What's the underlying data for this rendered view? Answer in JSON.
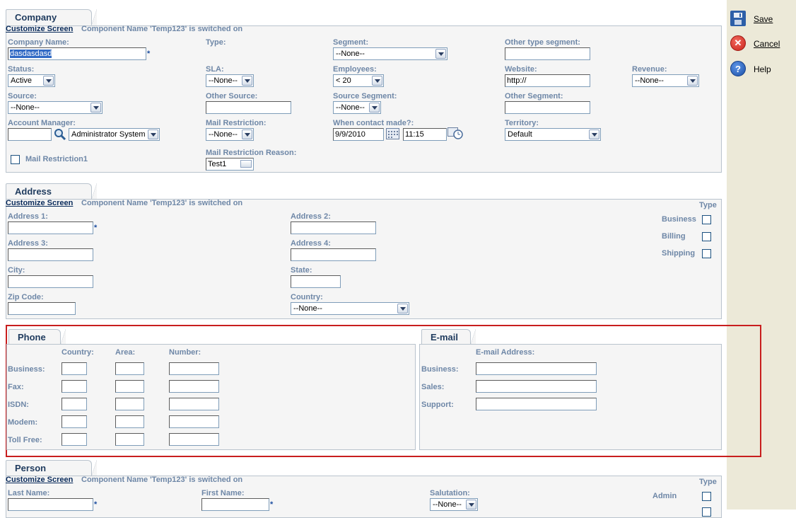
{
  "side": {
    "save_label": "Save",
    "cancel_label": "Cancel",
    "help_label": "Help"
  },
  "customize": {
    "link": "Customize Screen",
    "note": "Component Name 'Temp123' is switched on"
  },
  "company": {
    "tab": "Company",
    "company_name_label": "Company Name:",
    "company_name_value": "dasdasdasd",
    "type_label": "Type:",
    "segment_label": "Segment:",
    "segment_value": "--None--",
    "other_type_segment_label": "Other type segment:",
    "status_label": "Status:",
    "status_value": "Active",
    "sla_label": "SLA:",
    "sla_value": "--None--",
    "employees_label": "Employees:",
    "employees_value": "< 20",
    "website_label": "Website:",
    "website_value": "http://",
    "revenue_label": "Revenue:",
    "revenue_value": "--None--",
    "source_label": "Source:",
    "source_value": "--None--",
    "other_source_label": "Other Source:",
    "source_segment_label": "Source Segment:",
    "source_segment_value": "--None--",
    "other_segment_label": "Other Segment:",
    "account_manager_label": "Account Manager:",
    "account_manager_value": "Administrator System",
    "mail_restriction_label": "Mail Restriction:",
    "mail_restriction_value": "--None--",
    "contact_made_label": "When contact made?:",
    "contact_date": "9/9/2010",
    "contact_time": "11:15",
    "territory_label": "Territory:",
    "territory_value": "Default",
    "mail_restriction1_label": "Mail Restriction1",
    "mail_restriction_reason_label": "Mail Restriction Reason:",
    "mail_restriction_reason_value": "Test1"
  },
  "address": {
    "tab": "Address",
    "address1_label": "Address 1:",
    "address2_label": "Address 2:",
    "address3_label": "Address 3:",
    "address4_label": "Address 4:",
    "city_label": "City:",
    "state_label": "State:",
    "zip_label": "Zip Code:",
    "country_label": "Country:",
    "country_value": "--None--",
    "type_label": "Type",
    "business_label": "Business",
    "billing_label": "Billing",
    "shipping_label": "Shipping"
  },
  "phone": {
    "tab": "Phone",
    "col_country": "Country:",
    "col_area": "Area:",
    "col_number": "Number:",
    "rows": [
      "Business:",
      "Fax:",
      "ISDN:",
      "Modem:",
      "Toll Free:"
    ]
  },
  "email": {
    "tab": "E-mail",
    "col_address": "E-mail Address:",
    "rows": [
      "Business:",
      "Sales:",
      "Support:"
    ]
  },
  "person": {
    "tab": "Person",
    "last_name_label": "Last Name:",
    "first_name_label": "First Name:",
    "salutation_label": "Salutation:",
    "salutation_value": "--None--",
    "type_label": "Type",
    "admin_label": "Admin"
  },
  "colors": {
    "label": "#6e87a7",
    "link": "#0a2b5b",
    "highlight_box": "#c81e1e",
    "panel_bg": "#f5f5f5"
  }
}
